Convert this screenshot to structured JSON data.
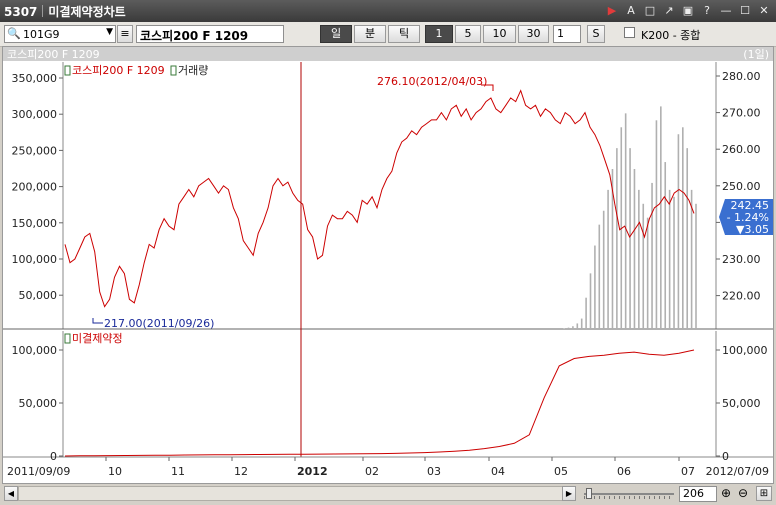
{
  "window": {
    "title_code": "5307",
    "title_name": "미결제약정차트",
    "controls": [
      "▶",
      "A",
      "□",
      "↗",
      "▣",
      "?",
      "—",
      "☐",
      "✕"
    ]
  },
  "toolbar": {
    "code_value": "101G9",
    "name_value": "코스피200 F 1209",
    "period_buttons": [
      "일",
      "분",
      "틱"
    ],
    "active_period": "일",
    "interval_buttons": [
      "1",
      "5",
      "10",
      "30"
    ],
    "active_interval": "1",
    "interval_input": "1",
    "s_button": "S",
    "compare_label": "K200 - 종합"
  },
  "chart_header": {
    "name": "코스피200 F 1209",
    "period": "(1일)"
  },
  "upper_panel": {
    "legend_price": "코스피200 F 1209",
    "legend_volume": "거래량",
    "annotation_high": "276.10(2012/04/03)",
    "annotation_low": "217.00(2011/09/26)",
    "left_ticks": [
      "350,000",
      "300,000",
      "250,000",
      "200,000",
      "150,000",
      "100,000",
      "50,000"
    ],
    "right_ticks": [
      "280.00",
      "270.00",
      "260.00",
      "250.00",
      "240.00",
      "230.00",
      "220.00"
    ],
    "price_box": {
      "price": "242.45",
      "change_pct": "- 1.24%",
      "change": "▼3.05"
    }
  },
  "lower_panel": {
    "legend": "미결제약정",
    "left_ticks": [
      "100,000",
      "50,000",
      "0"
    ],
    "right_ticks": [
      "100,000",
      "50,000",
      "0"
    ]
  },
  "x_axis": {
    "start": "2011/09/09",
    "labels": [
      "10",
      "11",
      "12",
      "2012",
      "02",
      "03",
      "04",
      "05",
      "06",
      "07"
    ],
    "end": "2012/07/09"
  },
  "bottombar": {
    "count": "206"
  },
  "chart_data": [
    {
      "type": "line",
      "name": "코스피200 F 1209",
      "x_start": "2011/09/09",
      "x_end": "2012/07/09",
      "ylim": [
        215,
        282
      ],
      "values": [
        234,
        229,
        230,
        233,
        236,
        237,
        232,
        221,
        217,
        219,
        225,
        228,
        226,
        219,
        218,
        223,
        229,
        234,
        233,
        238,
        241,
        239,
        238,
        245,
        247,
        249,
        247,
        250,
        251,
        252,
        250,
        248,
        250,
        249,
        244,
        241,
        235,
        233,
        231,
        237,
        240,
        244,
        250,
        252,
        250,
        251,
        248,
        246,
        245,
        238,
        236,
        230,
        231,
        239,
        242,
        241,
        241,
        243,
        242,
        240,
        246,
        245,
        247,
        244,
        249,
        252,
        254,
        259,
        262,
        263,
        265,
        264,
        266,
        267,
        268,
        268,
        270,
        268,
        271,
        272,
        269,
        271,
        268,
        270,
        271,
        273,
        274,
        271,
        270,
        272,
        274,
        273,
        276,
        272,
        271,
        272,
        269,
        271,
        270,
        268,
        267,
        270,
        269,
        267,
        268,
        270,
        266,
        264,
        261,
        257,
        253,
        245,
        238,
        239,
        236,
        238,
        240,
        236,
        241,
        244,
        245,
        247,
        245,
        248,
        249,
        248,
        246,
        242.45
      ],
      "color": "#cc0000"
    },
    {
      "type": "bar",
      "name": "거래량",
      "description_of_values": "daily volume, near zero until 2012/06 then rising",
      "ylim": [
        0,
        375000
      ],
      "values": [
        0,
        0,
        0,
        0,
        0,
        0,
        0,
        0,
        0,
        0,
        0,
        0,
        0,
        0,
        0,
        0,
        0,
        0,
        0,
        0,
        0,
        0,
        0,
        0,
        0,
        0,
        0,
        0,
        0,
        0,
        0,
        0,
        0,
        0,
        0,
        0,
        0,
        0,
        0,
        0,
        0,
        0,
        0,
        0,
        0,
        0,
        0,
        0,
        0,
        0,
        0,
        0,
        0,
        0,
        0,
        0,
        0,
        0,
        0,
        0,
        0,
        0,
        0,
        0,
        0,
        0,
        0,
        0,
        0,
        0,
        0,
        0,
        0,
        0,
        0,
        0,
        0,
        0,
        0,
        0,
        0,
        0,
        0,
        0,
        0,
        0,
        0,
        0,
        0,
        0,
        0,
        0,
        0,
        0,
        0,
        0,
        0,
        0,
        0,
        0,
        0,
        0,
        0,
        0,
        0,
        0,
        0,
        0,
        0,
        0,
        0,
        0,
        0,
        0,
        1000,
        2000,
        4000,
        8000,
        15000,
        45000,
        80000,
        120000,
        150000,
        170000,
        200000,
        230000,
        260000,
        290000,
        310000,
        260000,
        230000,
        200000,
        180000,
        160000,
        210000,
        300000,
        320000,
        240000,
        200000,
        190000,
        280000,
        290000,
        260000,
        200000,
        180000
      ],
      "color": "#b0b0b0"
    },
    {
      "type": "area",
      "name": "미결제약정",
      "ylim": [
        0,
        110000
      ],
      "values": [
        0,
        200,
        300,
        400,
        500,
        600,
        700,
        800,
        900,
        1000,
        1100,
        1200,
        1300,
        1400,
        1500,
        1600,
        1700,
        1800,
        1900,
        2000,
        2100,
        2300,
        2500,
        2800,
        3200,
        3800,
        4500,
        5500,
        7000,
        9000,
        12000,
        20000,
        55000,
        85000,
        92000,
        94000,
        95000,
        97000,
        98000,
        96000,
        95000,
        97000,
        100000
      ],
      "color": "#cc0000"
    }
  ]
}
